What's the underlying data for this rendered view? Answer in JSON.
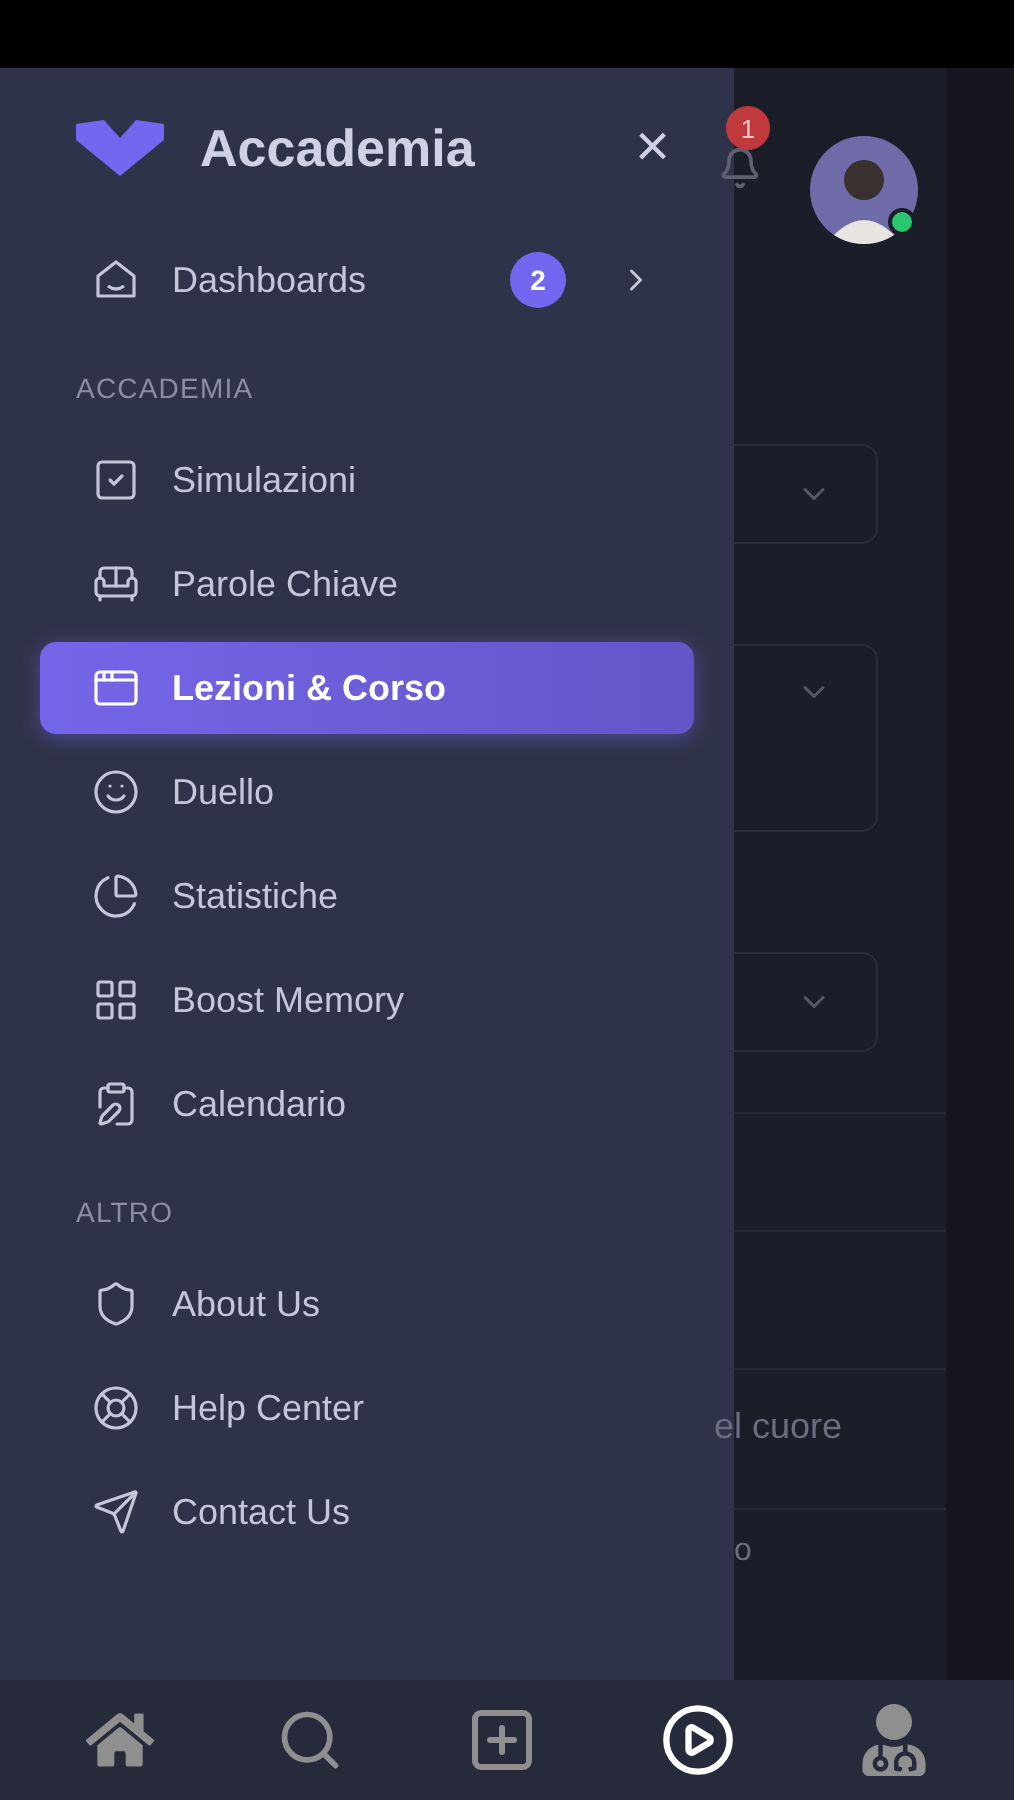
{
  "drawer": {
    "brand": "Accademia",
    "close_label": "×",
    "top_item": {
      "label": "Dashboards",
      "badge": "2",
      "selected": false
    },
    "sections": [
      {
        "header": "ACCADEMIA",
        "items": [
          {
            "label": "Simulazioni",
            "selected": false
          },
          {
            "label": "Parole Chiave",
            "selected": false
          },
          {
            "label": "Lezioni & Corso",
            "selected": true
          },
          {
            "label": "Duello",
            "selected": false
          },
          {
            "label": "Statistiche",
            "selected": false
          },
          {
            "label": "Boost Memory",
            "selected": false
          },
          {
            "label": "Calendario",
            "selected": false
          }
        ]
      },
      {
        "header": "ALTRO",
        "items": [
          {
            "label": "About Us",
            "selected": false
          },
          {
            "label": "Help Center",
            "selected": false
          },
          {
            "label": "Contact Us",
            "selected": false
          }
        ]
      }
    ]
  },
  "background": {
    "notification_count": "1",
    "user_online": true,
    "texts": [
      "el cuore",
      "o"
    ]
  },
  "bottom_nav": [
    {
      "selected": false
    },
    {
      "selected": false
    },
    {
      "selected": false
    },
    {
      "selected": true
    },
    {
      "selected": false
    }
  ]
}
